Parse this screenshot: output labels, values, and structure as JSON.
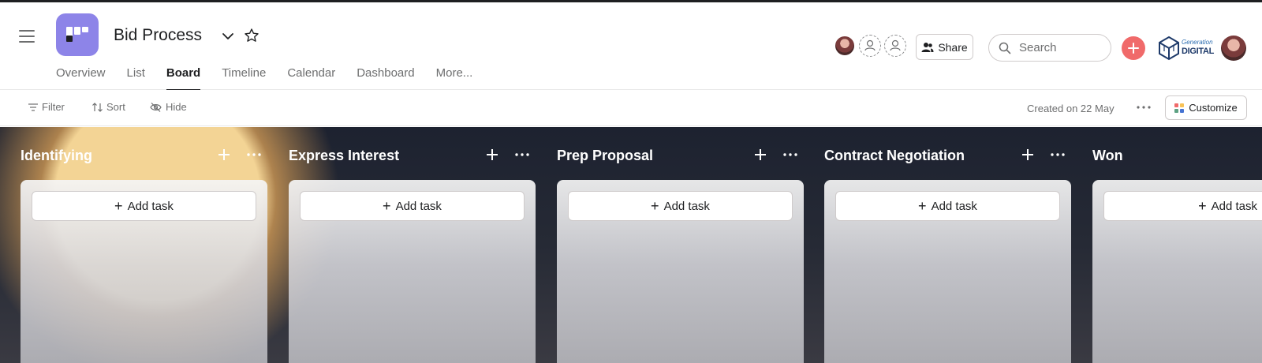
{
  "project": {
    "title": "Bid Process",
    "icon": "project-board-icon",
    "color": "#8d84e8"
  },
  "tabs": [
    {
      "label": "Overview"
    },
    {
      "label": "List"
    },
    {
      "label": "Board"
    },
    {
      "label": "Timeline"
    },
    {
      "label": "Calendar"
    },
    {
      "label": "Dashboard"
    },
    {
      "label": "More..."
    }
  ],
  "active_tab": "Board",
  "header": {
    "share_label": "Share",
    "search_placeholder": "Search",
    "logo_line1": "Generation",
    "logo_line2": "DIGITAL",
    "add_color": "#f06a6a"
  },
  "toolbar": {
    "filter_label": "Filter",
    "sort_label": "Sort",
    "hide_label": "Hide",
    "created_text": "Created on 22 May",
    "customize_label": "Customize"
  },
  "columns": [
    {
      "title": "Identifying",
      "add_task_label": "Add task"
    },
    {
      "title": "Express Interest",
      "add_task_label": "Add task"
    },
    {
      "title": "Prep Proposal",
      "add_task_label": "Add task"
    },
    {
      "title": "Contract Negotiation",
      "add_task_label": "Add task"
    },
    {
      "title": "Won",
      "add_task_label": "Add task"
    }
  ]
}
